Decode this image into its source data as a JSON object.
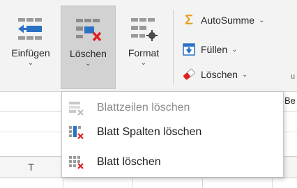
{
  "ribbon": {
    "cells_group": {
      "insert_label": "Einfügen",
      "delete_label": "Löschen",
      "format_label": "Format"
    },
    "editing_group": {
      "autosum_label": "AutoSumme",
      "fill_label": "Füllen",
      "clear_label": "Löschen"
    },
    "cut_off_texts": [
      "u",
      "Be"
    ]
  },
  "sheet": {
    "visible_column_header": "T"
  },
  "delete_menu": {
    "items": [
      {
        "label": "Blattzeilen löschen",
        "icon": "delete-rows-icon",
        "enabled": false
      },
      {
        "label": "Blatt Spalten löschen",
        "icon": "delete-columns-icon",
        "enabled": true
      },
      {
        "label": "Blatt löschen",
        "icon": "delete-sheet-icon",
        "enabled": true
      }
    ]
  },
  "colors": {
    "accent_blue": "#2b72c4",
    "delete_red": "#e0201c",
    "autosum_orange": "#e8a227",
    "ribbon_bg": "#f3f3f3",
    "pressed_bg": "#d2d2d2",
    "disabled_text": "#8a8a8a"
  }
}
